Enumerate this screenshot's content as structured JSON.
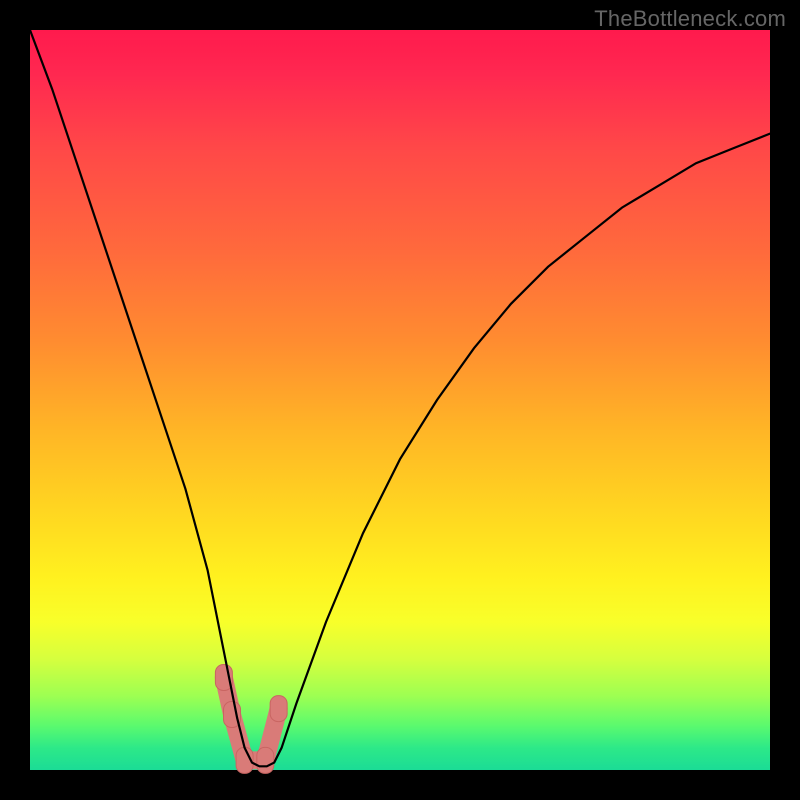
{
  "watermark": "TheBottleneck.com",
  "chart_data": {
    "type": "line",
    "title": "",
    "xlabel": "",
    "ylabel": "",
    "xlim": [
      0,
      100
    ],
    "ylim": [
      0,
      100
    ],
    "series": [
      {
        "name": "bottleneck-curve",
        "x": [
          0,
          3,
          6,
          9,
          12,
          15,
          18,
          21,
          24,
          26,
          27,
          28,
          29,
          30,
          31,
          32,
          33,
          34,
          36,
          40,
          45,
          50,
          55,
          60,
          65,
          70,
          75,
          80,
          85,
          90,
          95,
          100
        ],
        "y": [
          100,
          92,
          83,
          74,
          65,
          56,
          47,
          38,
          27,
          17,
          12,
          7,
          3,
          1,
          0.5,
          0.5,
          1,
          3,
          9,
          20,
          32,
          42,
          50,
          57,
          63,
          68,
          72,
          76,
          79,
          82,
          84,
          86
        ]
      }
    ],
    "markers": [
      {
        "name": "range-start-outer",
        "x": 26.2,
        "y": 12.5
      },
      {
        "name": "range-start-inner",
        "x": 27.3,
        "y": 7.5
      },
      {
        "name": "range-floor-left",
        "x": 29.0,
        "y": 1.3
      },
      {
        "name": "range-floor-right",
        "x": 31.8,
        "y": 1.3
      },
      {
        "name": "range-end",
        "x": 33.6,
        "y": 8.3
      }
    ],
    "marker_path": [
      {
        "x": 26.2,
        "y": 12.5
      },
      {
        "x": 27.3,
        "y": 7.5
      },
      {
        "x": 29.0,
        "y": 1.3
      },
      {
        "x": 31.8,
        "y": 1.3
      },
      {
        "x": 33.6,
        "y": 8.3
      }
    ],
    "colors": {
      "curve": "#000000",
      "marker_fill": "#d97b78",
      "marker_stroke": "#c96562"
    }
  }
}
